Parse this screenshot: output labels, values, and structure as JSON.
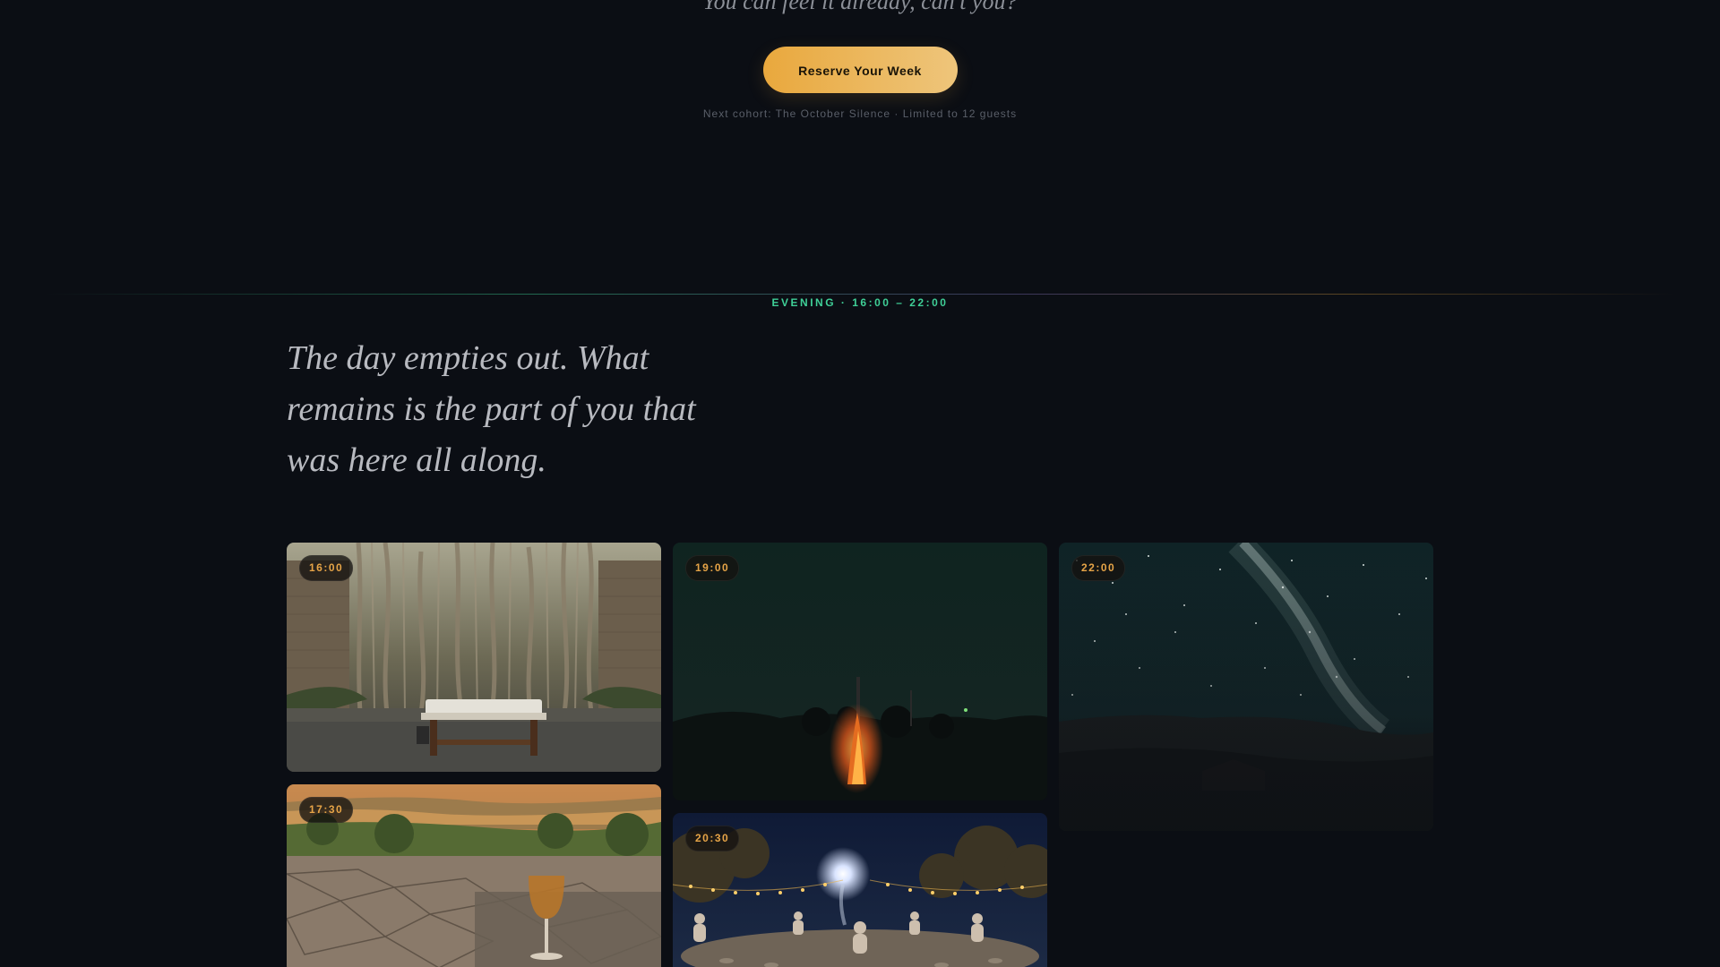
{
  "hero": {
    "tagline": "You can feel it already, can't you?",
    "cta_label": "Reserve Your Week",
    "cohort_note": "Next cohort: The October Silence · Limited to 12 guests"
  },
  "section": {
    "label": "EVENING · 16:00 – 22:00",
    "quote": "The day empties out. What remains is the part of you that was here all along."
  },
  "gallery": {
    "cards": [
      {
        "time": "16:00",
        "scene": "banyan courtyard massage table"
      },
      {
        "time": "17:30",
        "scene": "stone terrace with glass at sunset over fields"
      },
      {
        "time": "19:00",
        "scene": "fire under dusk sky"
      },
      {
        "time": "20:30",
        "scene": "meditation circle with string lights under moon"
      },
      {
        "time": "22:00",
        "scene": "milky way over hills"
      }
    ]
  },
  "colors": {
    "background": "#0b0e14",
    "accent_gold": "#e9a83d",
    "accent_green": "#3fcf97"
  }
}
